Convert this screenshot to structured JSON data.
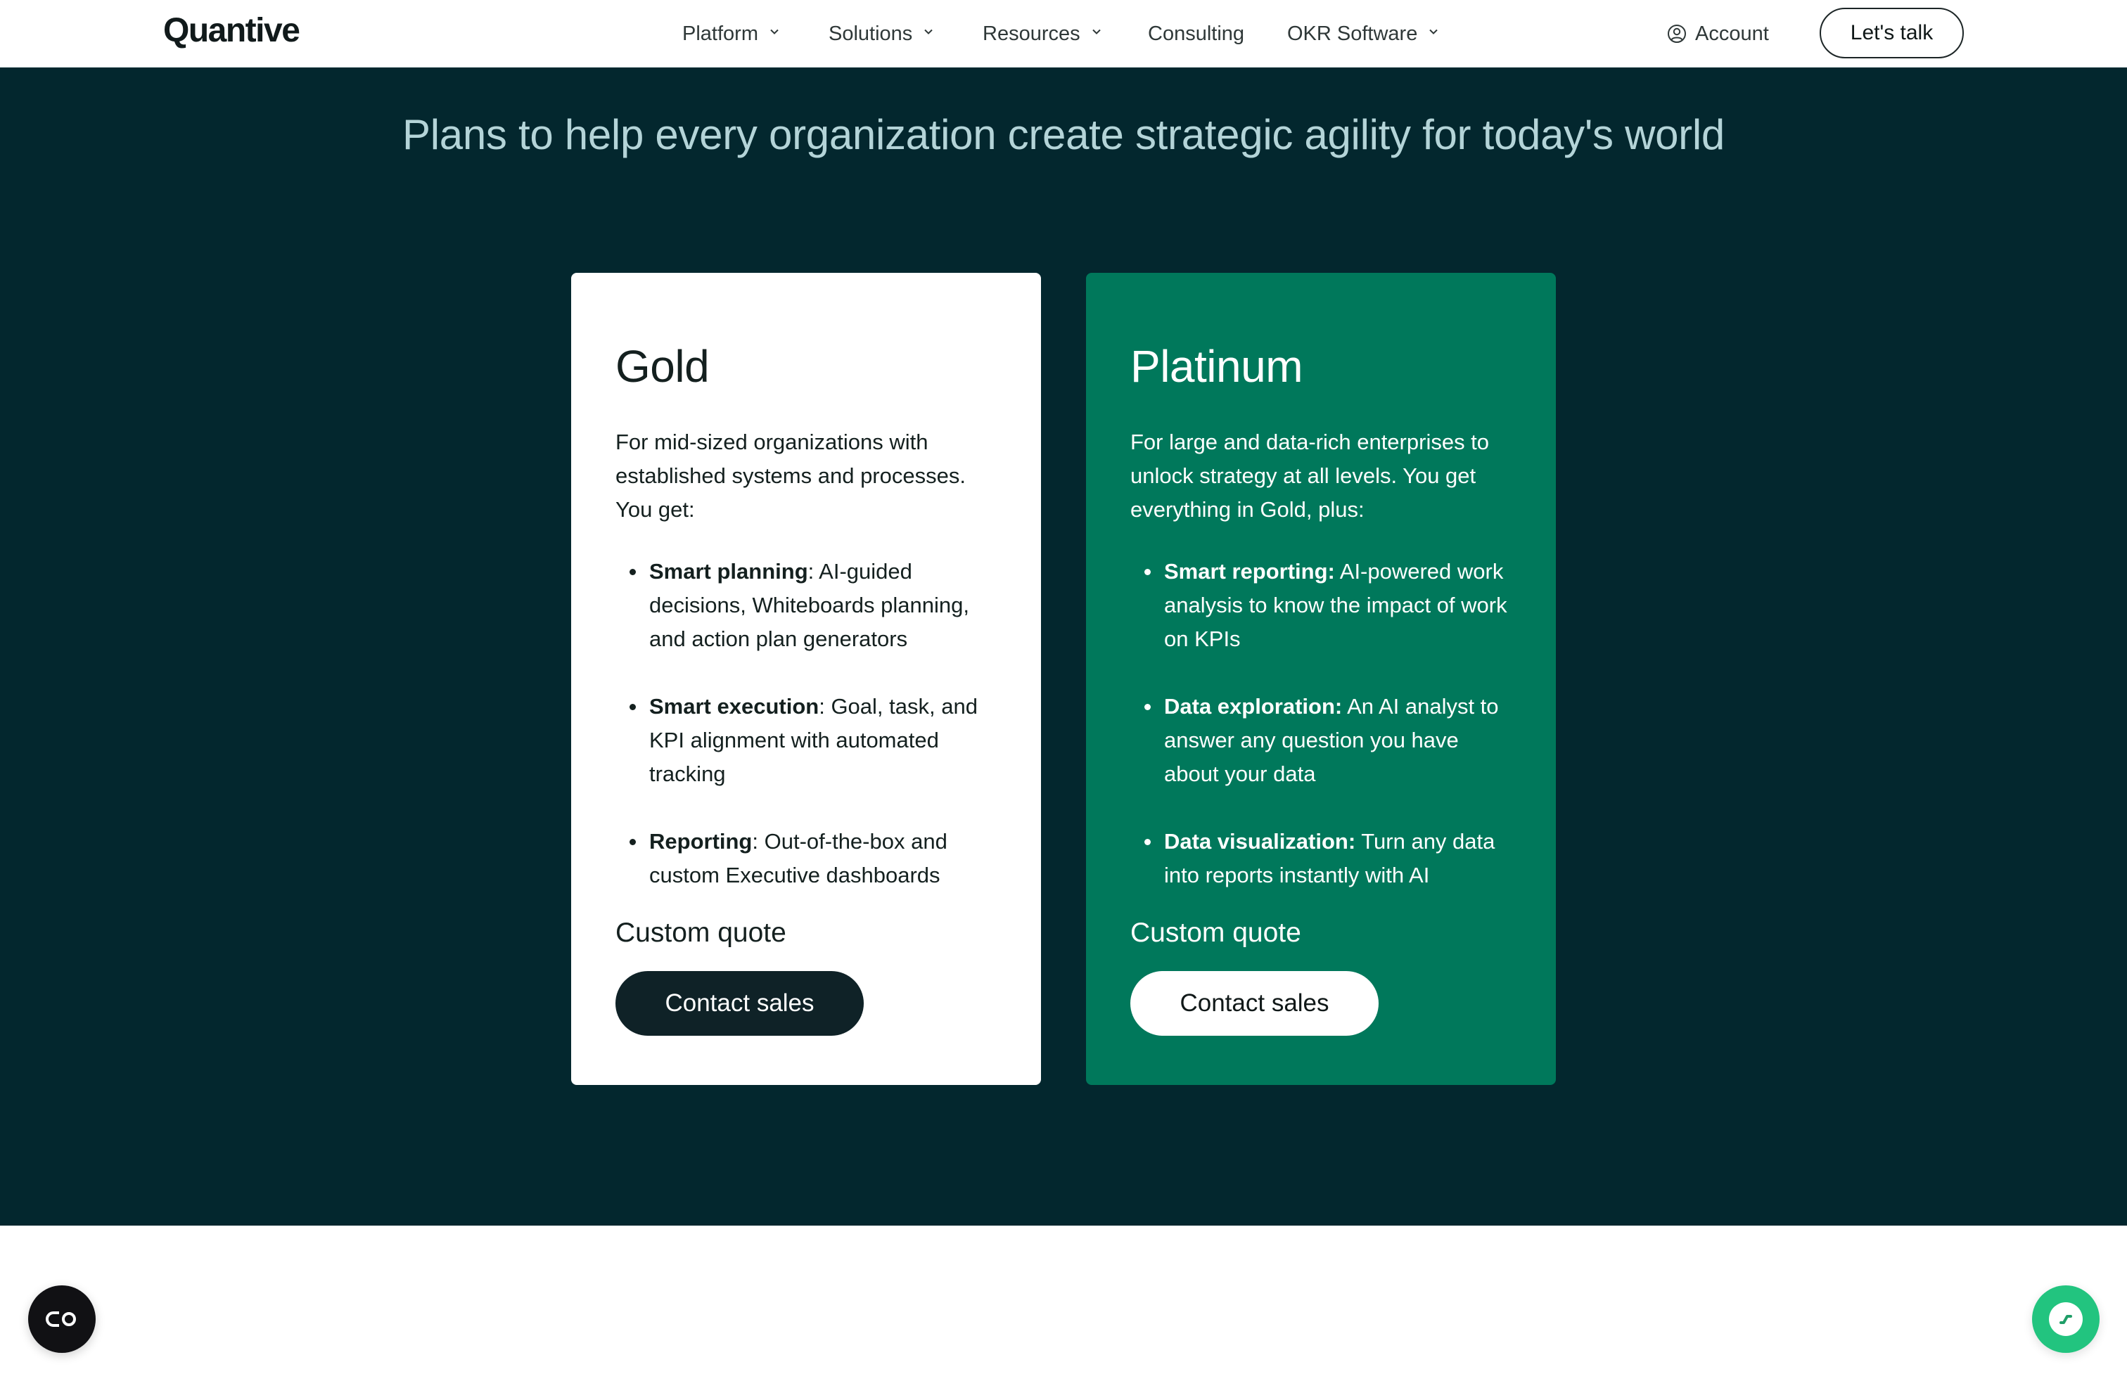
{
  "brand": {
    "logo_text": "Quantive"
  },
  "nav": {
    "items": [
      {
        "label": "Platform",
        "has_dropdown": true
      },
      {
        "label": "Solutions",
        "has_dropdown": true
      },
      {
        "label": "Resources",
        "has_dropdown": true
      },
      {
        "label": "Consulting",
        "has_dropdown": false
      },
      {
        "label": "OKR Software",
        "has_dropdown": true
      }
    ],
    "account_label": "Account",
    "cta_label": "Let's talk"
  },
  "hero": {
    "title": "Plans to help every organization create strategic agility for today's world"
  },
  "plans": [
    {
      "name": "Gold",
      "description": "For mid-sized organizations with established systems and processes. You get:",
      "features": [
        {
          "title": "Smart planning",
          "sep": ": ",
          "text": "AI-guided decisions, Whiteboards planning, and action plan generators"
        },
        {
          "title": "Smart execution",
          "sep": ": ",
          "text": "Goal, task, and KPI alignment with automated tracking"
        },
        {
          "title": "Reporting",
          "sep": ": ",
          "text": "Out-of-the-box and custom Executive dashboards"
        }
      ],
      "price": "Custom quote",
      "cta_label": "Contact sales"
    },
    {
      "name": "Platinum",
      "description": "For large and data-rich enterprises to unlock strategy at all levels. You get everything in Gold, plus:",
      "features": [
        {
          "title": "Smart reporting:",
          "sep": " ",
          "text": "AI-powered work analysis to know the impact of work on KPIs"
        },
        {
          "title": "Data exploration:",
          "sep": " ",
          "text": "An AI analyst to answer any question you have about your data"
        },
        {
          "title": "Data visualization:",
          "sep": " ",
          "text": "Turn any data into reports instantly with AI"
        }
      ],
      "price": "Custom quote",
      "cta_label": "Contact sales"
    }
  ],
  "floating": {
    "left_icon": "accessibility-toggle-icon",
    "right_icon": "chat-icon"
  },
  "colors": {
    "hero_bg": "#03272e",
    "platinum_bg": "#00785b",
    "chat_green": "#22c47f",
    "dark_button": "#0f2227"
  }
}
